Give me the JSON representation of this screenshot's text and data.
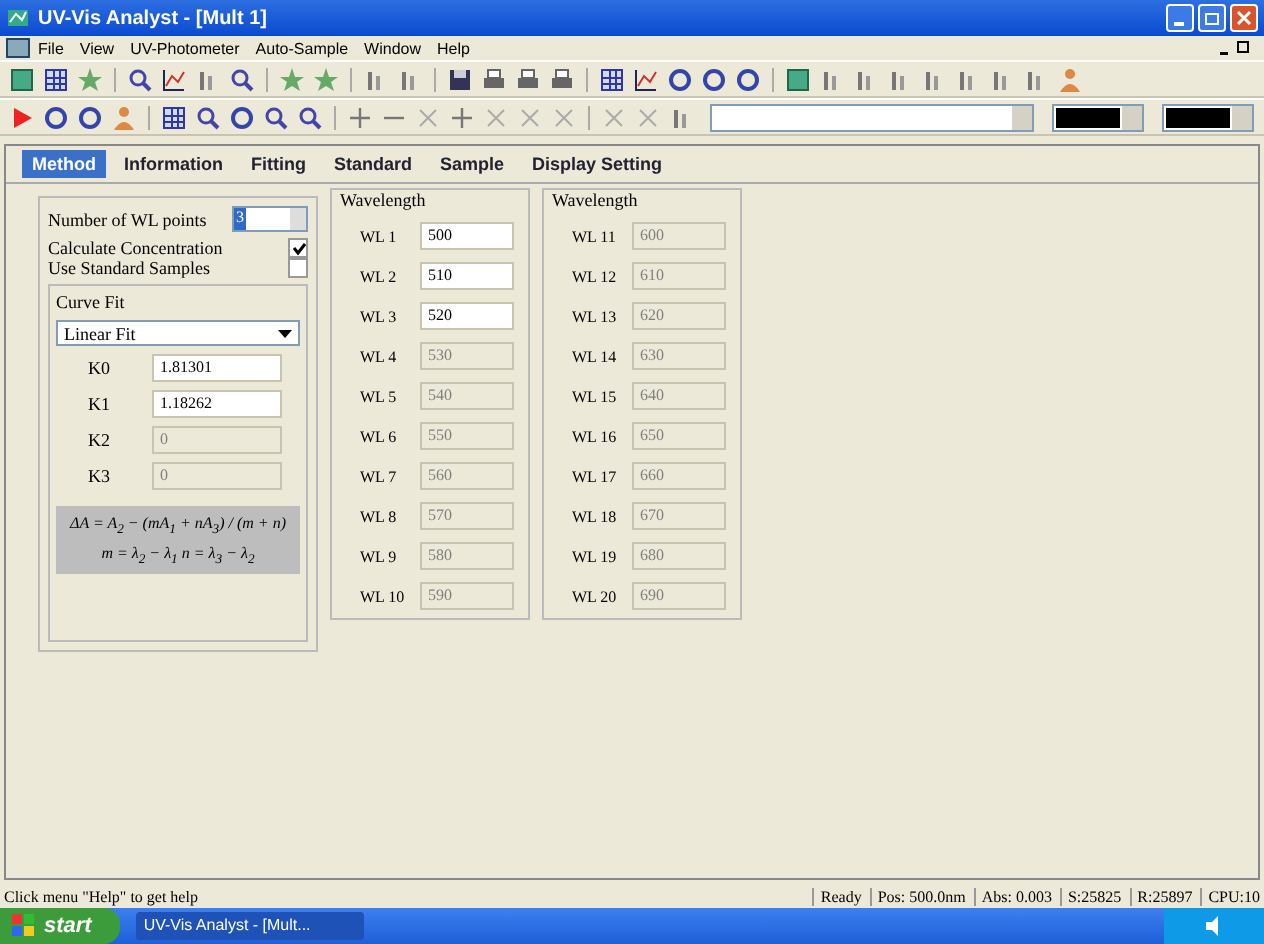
{
  "window": {
    "title": "UV-Vis Analyst - [Mult 1]"
  },
  "menu": [
    "File",
    "View",
    "UV-Photometer",
    "Auto-Sample",
    "Window",
    "Help"
  ],
  "tabs": [
    {
      "label": "Method",
      "selected": true
    },
    {
      "label": "Information",
      "selected": false
    },
    {
      "label": "Fitting",
      "selected": false
    },
    {
      "label": "Standard",
      "selected": false
    },
    {
      "label": "Sample",
      "selected": false
    },
    {
      "label": "Display Setting",
      "selected": false
    }
  ],
  "method": {
    "wl_points_label": "Number of WL points",
    "wl_points": "3",
    "options": [
      {
        "label": "Calculate Concentration",
        "checked": true
      },
      {
        "label": "Use Standard Samples",
        "checked": false
      }
    ],
    "curve_fit": {
      "title": "Curve Fit",
      "model": "Linear Fit",
      "coefficients": [
        {
          "label": "K0",
          "value": "1.81301",
          "disabled": false
        },
        {
          "label": "K1",
          "value": "1.18262",
          "disabled": false
        },
        {
          "label": "K2",
          "value": "0",
          "disabled": true
        },
        {
          "label": "K3",
          "value": "0",
          "disabled": true
        }
      ],
      "formula": [
        "ΔA = A$_{2}$ − (mA$_{1}$ + nA$_{3}$) / (m + n)",
        "m = λ$_{2}$ − λ$_{1}$  n = λ$_{3}$ − λ$_{2}$"
      ]
    }
  },
  "wavelength_groups": [
    {
      "title": "Wavelength",
      "points": [
        {
          "label": "WL 1",
          "value": "500",
          "disabled": false
        },
        {
          "label": "WL 2",
          "value": "510",
          "disabled": false
        },
        {
          "label": "WL 3",
          "value": "520",
          "disabled": false
        },
        {
          "label": "WL 4",
          "value": "530",
          "disabled": true
        },
        {
          "label": "WL 5",
          "value": "540",
          "disabled": true
        },
        {
          "label": "WL 6",
          "value": "550",
          "disabled": true
        },
        {
          "label": "WL 7",
          "value": "560",
          "disabled": true
        },
        {
          "label": "WL 8",
          "value": "570",
          "disabled": true
        },
        {
          "label": "WL 9",
          "value": "580",
          "disabled": true
        },
        {
          "label": "WL 10",
          "value": "590",
          "disabled": true
        }
      ]
    },
    {
      "title": "Wavelength",
      "points": [
        {
          "label": "WL 11",
          "value": "600",
          "disabled": true
        },
        {
          "label": "WL 12",
          "value": "610",
          "disabled": true
        },
        {
          "label": "WL 13",
          "value": "620",
          "disabled": true
        },
        {
          "label": "WL 14",
          "value": "630",
          "disabled": true
        },
        {
          "label": "WL 15",
          "value": "640",
          "disabled": true
        },
        {
          "label": "WL 16",
          "value": "650",
          "disabled": true
        },
        {
          "label": "WL 17",
          "value": "660",
          "disabled": true
        },
        {
          "label": "WL 18",
          "value": "670",
          "disabled": true
        },
        {
          "label": "WL 19",
          "value": "680",
          "disabled": true
        },
        {
          "label": "WL 20",
          "value": "690",
          "disabled": true
        }
      ]
    }
  ],
  "status_bar": {
    "message": "Click menu \"Help\" to get help",
    "panes": [
      "Ready",
      "Pos: 500.0nm",
      "Abs: 0.003",
      "S:25825",
      "R:25897",
      "CPU:10"
    ]
  },
  "taskbar": {
    "start": "start",
    "buttons": [
      {
        "label": "UV-Vis Analyst - [Mult...",
        "selected": true
      }
    ]
  }
}
